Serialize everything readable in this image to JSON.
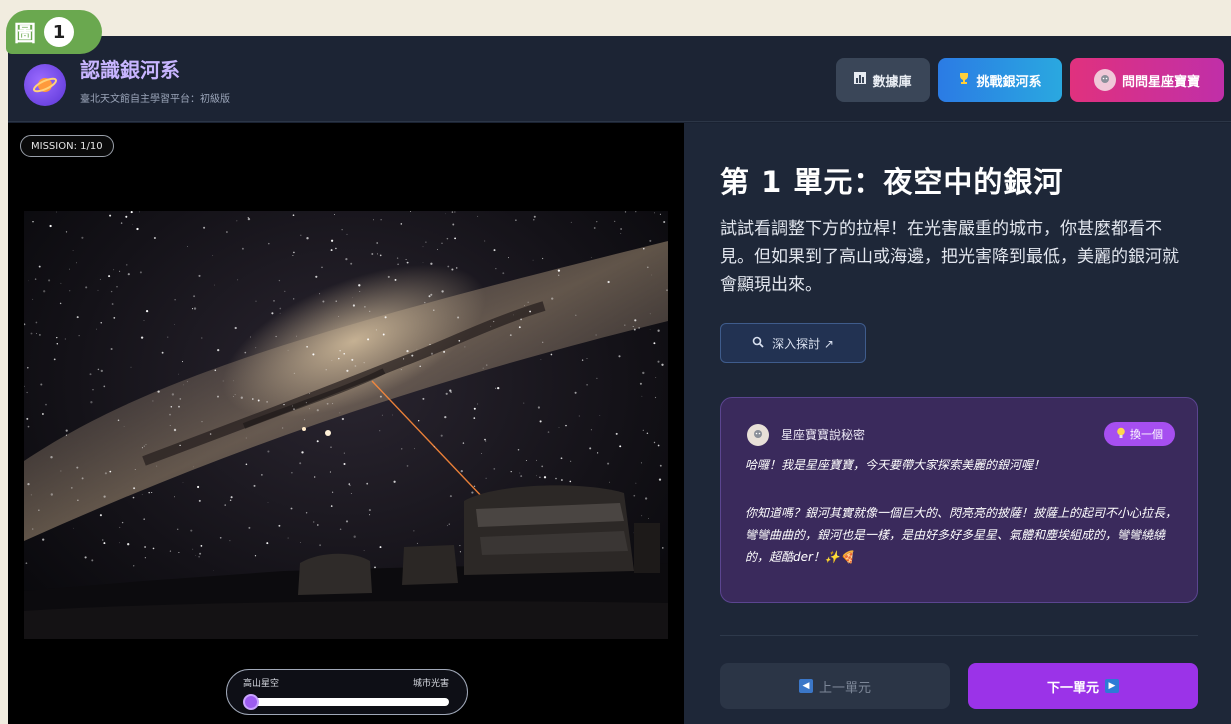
{
  "figure": {
    "glyph": "圖",
    "number": "1"
  },
  "header": {
    "logo_icon": "planet-icon",
    "title": "認識銀河系",
    "subtitle": "臺北天文館自主學習平台：初級版",
    "buttons": {
      "database": {
        "icon": "chart-icon",
        "label": "數據庫"
      },
      "challenge": {
        "icon": "trophy-icon",
        "label": "挑戰銀河系"
      },
      "ask": {
        "icon": "avatar-icon",
        "label": "問問星座寶寶"
      }
    }
  },
  "left": {
    "mission": "MISSION: 1/10",
    "slider": {
      "left_label": "高山星空",
      "right_label": "城市光害",
      "value": 0
    }
  },
  "main": {
    "unit_title": "第 1 單元：夜空中的銀河",
    "description": "試試看調整下方的拉桿！在光害嚴重的城市，你甚麼都看不見。但如果到了高山或海邊，把光害降到最低，美麗的銀河就會顯現出來。",
    "explore_label": "深入探討 ↗",
    "secret": {
      "title": "星座寶寶說秘密",
      "swap_label": "換一個",
      "para1": "哈囉！我是星座寶寶，今天要帶大家探索美麗的銀河喔！",
      "para2": "你知道嗎？銀河其實就像一個巨大的、閃亮亮的披薩！披薩上的起司不小心拉長，彎彎曲曲的，銀河也是一樣，是由好多好多星星、氣體和塵埃組成的，彎彎繞繞的，超酷der！✨🍕"
    },
    "nav": {
      "prev_label": "上一單元",
      "next_label": "下一單元"
    }
  },
  "colors": {
    "accent": "#9b33e8",
    "background": "#1a2232",
    "page": "#f1ecdf"
  }
}
